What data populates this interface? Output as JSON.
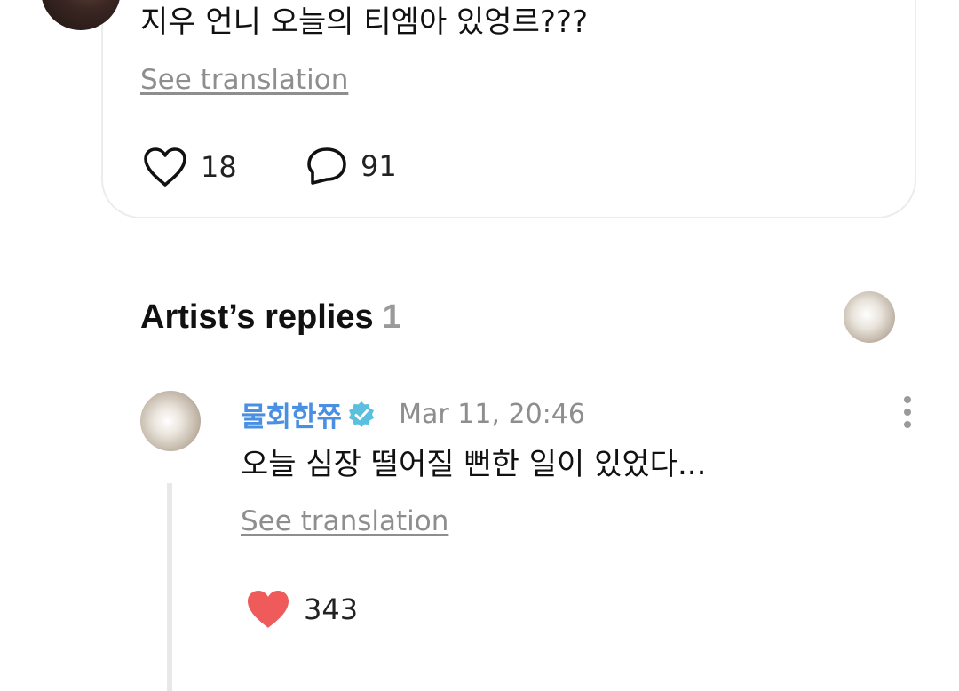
{
  "post": {
    "text": "지우 언니 오늘의 티엠아 있엉르???",
    "see_translation": "See translation",
    "likes": "18",
    "comments": "91"
  },
  "artist_replies": {
    "title": "Artist’s replies",
    "count": "1"
  },
  "reply": {
    "author": "물회한쮸",
    "verified": true,
    "timestamp": "Mar 11, 20:46",
    "text": "오늘 심장 떨어질 뻔한 일이 있었다...",
    "see_translation": "See translation",
    "likes": "343",
    "liked": true
  },
  "colors": {
    "accent_blue": "#4a90e2",
    "verified_badge": "#5bc0de",
    "liked_heart": "#ef5a5a",
    "muted_text": "#8e8e8e"
  },
  "icons": {
    "like": "heart-outline-icon",
    "comment": "speech-bubble-icon",
    "reply_like": "heart-filled-icon",
    "verified": "verified-badge-icon",
    "more": "more-vertical-icon"
  }
}
